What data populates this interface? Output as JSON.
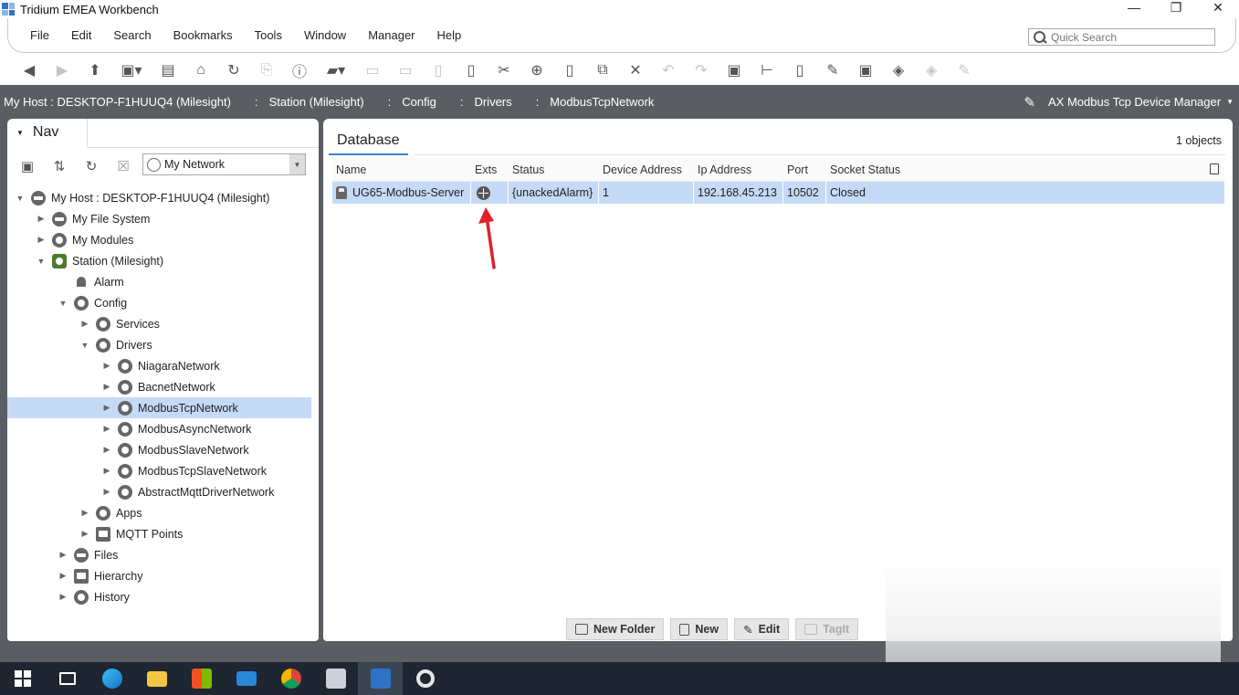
{
  "window": {
    "title": "Tridium EMEA Workbench",
    "controls": [
      "—",
      "❐",
      "✕"
    ]
  },
  "menubar": {
    "items": [
      "File",
      "Edit",
      "Search",
      "Bookmarks",
      "Tools",
      "Window",
      "Manager",
      "Help"
    ],
    "quick_search_placeholder": "Quick Search"
  },
  "toolbar": {
    "icons": [
      "back-icon",
      "forward-icon",
      "up-level-icon",
      "side-bar-icon",
      "open-folder-icon",
      "home-icon",
      "refresh-icon",
      "copy-ord-icon",
      "info-icon",
      "open-icon",
      "save-icon",
      "save-all-icon",
      "export-icon",
      "find-icon",
      "cut-icon",
      "copy-icon",
      "paste-icon",
      "duplicate-icon",
      "delete-icon",
      "undo-icon",
      "redo-icon",
      "new-folder-icon",
      "link-icon",
      "new-icon",
      "edit-icon",
      "discover-icon",
      "tag-icon",
      "tag-it-icon",
      "clear-icon"
    ]
  },
  "locbar": {
    "crumbs": [
      "My Host : DESKTOP-F1HUUQ4 (Milesight)",
      "Station (Milesight)",
      "Config",
      "Drivers",
      "ModbusTcpNetwork"
    ],
    "view_name": "AX Modbus Tcp Device Manager"
  },
  "nav": {
    "tab_label": "Nav",
    "network_select": "My Network",
    "tree": [
      {
        "label": "My Host : DESKTOP-F1HUUQ4 (Milesight)",
        "expanded": true
      },
      {
        "label": "My File System"
      },
      {
        "label": "My Modules"
      },
      {
        "label": "Station (Milesight)",
        "expanded": true
      },
      {
        "label": "Alarm"
      },
      {
        "label": "Config",
        "expanded": true
      },
      {
        "label": "Services"
      },
      {
        "label": "Drivers",
        "expanded": true
      },
      {
        "label": "NiagaraNetwork"
      },
      {
        "label": "BacnetNetwork"
      },
      {
        "label": "ModbusTcpNetwork",
        "selected": true
      },
      {
        "label": "ModbusAsyncNetwork"
      },
      {
        "label": "ModbusSlaveNetwork"
      },
      {
        "label": "ModbusTcpSlaveNetwork"
      },
      {
        "label": "AbstractMqttDriverNetwork"
      },
      {
        "label": "Apps"
      },
      {
        "label": "MQTT Points"
      },
      {
        "label": "Files"
      },
      {
        "label": "Hierarchy"
      },
      {
        "label": "History"
      }
    ]
  },
  "main": {
    "tab_label": "Database",
    "object_count": "1 objects",
    "columns": [
      "Name",
      "Exts",
      "Status",
      "Device Address",
      "Ip Address",
      "Port",
      "Socket Status"
    ],
    "rows": [
      {
        "name": "UG65-Modbus-Server",
        "status": "{unackedAlarm}",
        "device_address": "1",
        "ip_address": "192.168.45.213",
        "port": "10502",
        "socket_status": "Closed"
      }
    ],
    "buttons": {
      "new_folder": "New Folder",
      "new": "New",
      "edit": "Edit",
      "tagit": "TagIt"
    }
  },
  "colors": {
    "selection": "#c5daf6",
    "accent_tab": "#3d7fd1",
    "locbar_bg": "#5a5e63",
    "arrow": "#e0202a"
  },
  "taskbar": {
    "icons": [
      "windows-start-icon",
      "task-view-icon",
      "edge-icon",
      "file-explorer-icon",
      "store-icon",
      "mail-icon",
      "chrome-icon",
      "app-icon",
      "workbench-icon",
      "settings-icon"
    ]
  }
}
